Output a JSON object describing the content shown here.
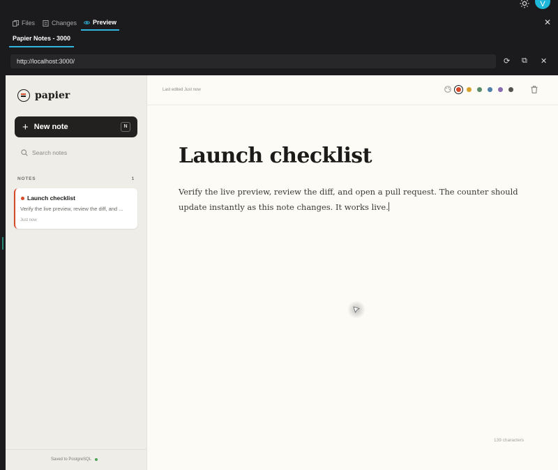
{
  "header": {
    "avatar_initial": "V"
  },
  "tabs": [
    {
      "label": "Files"
    },
    {
      "label": "Changes"
    },
    {
      "label": "Preview"
    }
  ],
  "subtab": {
    "label": "Papier Notes - 3000"
  },
  "url": {
    "value": "http://localhost:3000/"
  },
  "sidebar": {
    "logo_text": "papier",
    "new_note_label": "New note",
    "new_note_shortcut": "N",
    "search_placeholder": "Search notes",
    "notes_heading": "NOTES",
    "notes_count": "1",
    "notes": [
      {
        "title": "Launch checklist",
        "snippet": "Verify the live preview, review the diff, and ...",
        "time": "Just now"
      }
    ],
    "saved_status": "Saved to PostgreSQL"
  },
  "editor": {
    "last_edited": "Last edited Just now",
    "title": "Launch checklist",
    "body": "Verify the live preview, review the diff, and open a pull request. The counter should update instantly as this note changes. It works live.",
    "char_count": "139 characters",
    "colors": [
      "#d64a2a",
      "#d6a02a",
      "#5a8c6a",
      "#4e7fa8",
      "#8a6ab0",
      "#555350"
    ]
  },
  "colors": {
    "accent": "#2fb5e0",
    "note_accent": "#d64a2a"
  }
}
